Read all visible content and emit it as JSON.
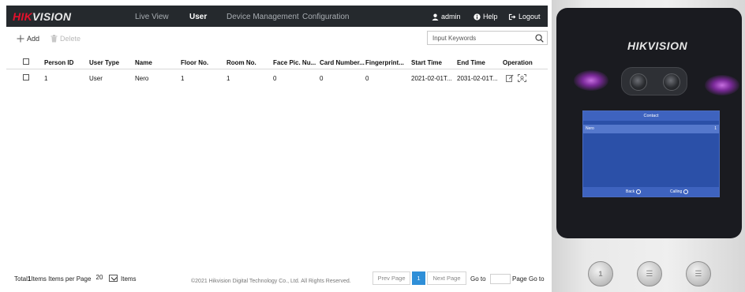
{
  "web": {
    "brand": {
      "part1": "HIK",
      "part2": "VISION"
    },
    "nav": {
      "live_view": "Live View",
      "user": "User",
      "device_management": "Device Management",
      "configuration": "Configuration"
    },
    "account": {
      "admin": "admin",
      "help": "Help",
      "logout": "Logout"
    },
    "toolbar": {
      "add": "Add",
      "delete": "Delete",
      "search_placeholder": "Input Keywords"
    },
    "table": {
      "headers": [
        "Person ID",
        "User Type",
        "Name",
        "Floor No.",
        "Room No.",
        "Face Pic. Nu...",
        "Card Number...",
        "Fingerprint...",
        "Start Time",
        "End Time",
        "Operation"
      ],
      "rows": [
        {
          "person_id": "1",
          "user_type": "User",
          "name": "Nero",
          "floor_no": "1",
          "room_no": "1",
          "face_pic": "0",
          "card_number": "0",
          "fingerprint": "0",
          "start_time": "2021-02-01T...",
          "end_time": "2031-02-01T..."
        }
      ]
    },
    "footer": {
      "total_prefix": "Total",
      "total_count": "1",
      "total_suffix": "Items Items per Page",
      "per_page": "20",
      "items_label": "Items",
      "copyright": "©2021 Hikvision Digital Technology Co., Ltd. All Rights Reserved.",
      "prev_page": "Prev Page",
      "current_page": "1",
      "next_page": "Next Page",
      "go_to": "Go to",
      "page_label": "Page",
      "go_to_button": "Go to"
    },
    "colors": {
      "topbar": "#25292d",
      "accent": "#2f8fd8",
      "brand_red": "#e3112c"
    }
  },
  "device": {
    "brand": "HIKVISION",
    "screen": {
      "title": "Contact",
      "contact_name": "Nero",
      "contact_number": "1",
      "back_label": "Back",
      "calling_label": "Calling"
    },
    "buttons": [
      "1",
      "",
      ""
    ]
  }
}
